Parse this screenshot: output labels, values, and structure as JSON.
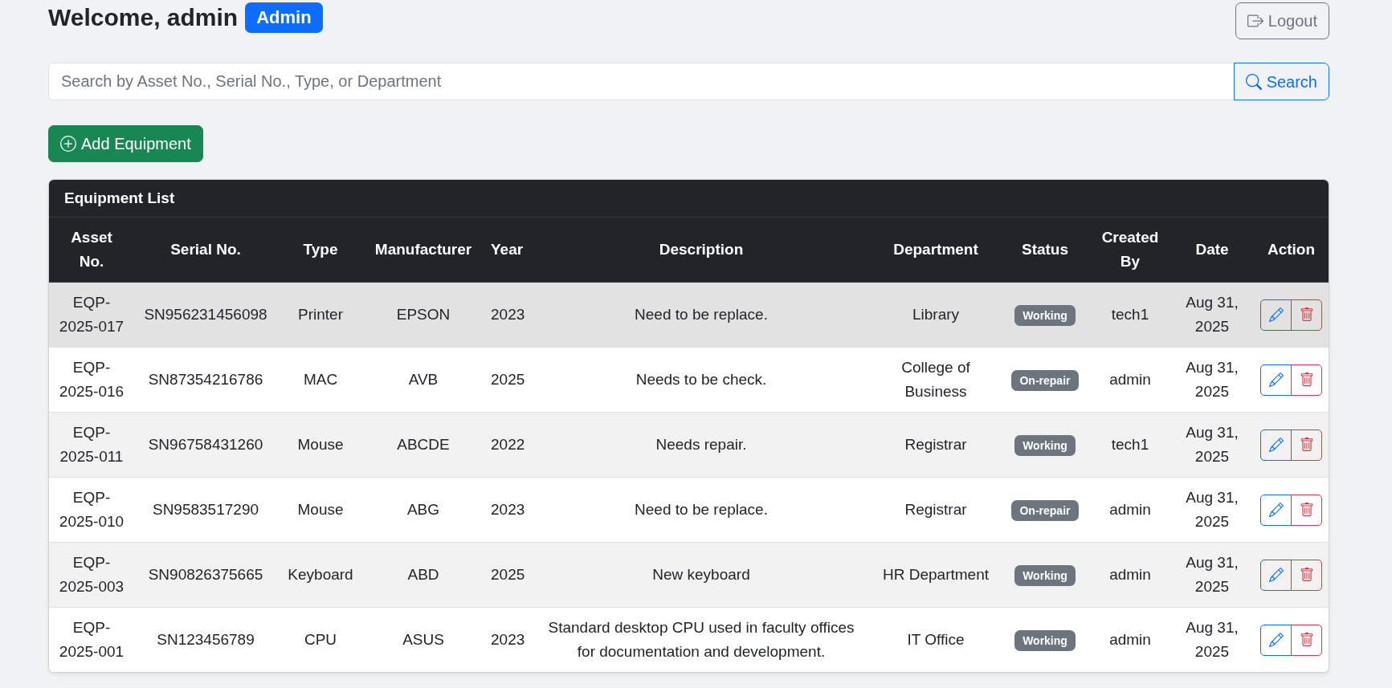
{
  "header": {
    "title": "Welcome, admin",
    "role_badge": "Admin",
    "logout_button": "Logout"
  },
  "search": {
    "placeholder": "Search by Asset No., Serial No., Type, or Department",
    "button": "Search"
  },
  "add_button": "Add Equipment",
  "equipment_card": {
    "title": "Equipment List",
    "columns": [
      "Asset No.",
      "Serial No.",
      "Type",
      "Manufacturer",
      "Year",
      "Description",
      "Department",
      "Status",
      "Created By",
      "Date",
      "Action"
    ],
    "rows": [
      {
        "asset_no": "EQP-2025-017",
        "serial_no": "SN956231456098",
        "type": "Printer",
        "manufacturer": "EPSON",
        "year": "2023",
        "description": "Need to be replace.",
        "department": "Library",
        "status": "Working",
        "created_by": "tech1",
        "date": "Aug 31, 2025",
        "hovered": true
      },
      {
        "asset_no": "EQP-2025-016",
        "serial_no": "SN87354216786",
        "type": "MAC",
        "manufacturer": "AVB",
        "year": "2025",
        "description": "Needs to be check.",
        "department": "College of Business",
        "status": "On-repair",
        "created_by": "admin",
        "date": "Aug 31, 2025",
        "hovered": false
      },
      {
        "asset_no": "EQP-2025-011",
        "serial_no": "SN96758431260",
        "type": "Mouse",
        "manufacturer": "ABCDE",
        "year": "2022",
        "description": "Needs repair.",
        "department": "Registrar",
        "status": "Working",
        "created_by": "tech1",
        "date": "Aug 31, 2025",
        "hovered": false
      },
      {
        "asset_no": "EQP-2025-010",
        "serial_no": "SN9583517290",
        "type": "Mouse",
        "manufacturer": "ABG",
        "year": "2023",
        "description": "Need to be replace.",
        "department": "Registrar",
        "status": "On-repair",
        "created_by": "admin",
        "date": "Aug 31, 2025",
        "hovered": false
      },
      {
        "asset_no": "EQP-2025-003",
        "serial_no": "SN90826375665",
        "type": "Keyboard",
        "manufacturer": "ABD",
        "year": "2025",
        "description": "New keyboard",
        "department": "HR Department",
        "status": "Working",
        "created_by": "admin",
        "date": "Aug 31, 2025",
        "hovered": false
      },
      {
        "asset_no": "EQP-2025-001",
        "serial_no": "SN123456789",
        "type": "CPU",
        "manufacturer": "ASUS",
        "year": "2023",
        "description": "Standard desktop CPU used in faculty offices for documentation and development.",
        "department": "IT Office",
        "status": "Working",
        "created_by": "admin",
        "date": "Aug 31, 2025",
        "hovered": false
      }
    ]
  }
}
